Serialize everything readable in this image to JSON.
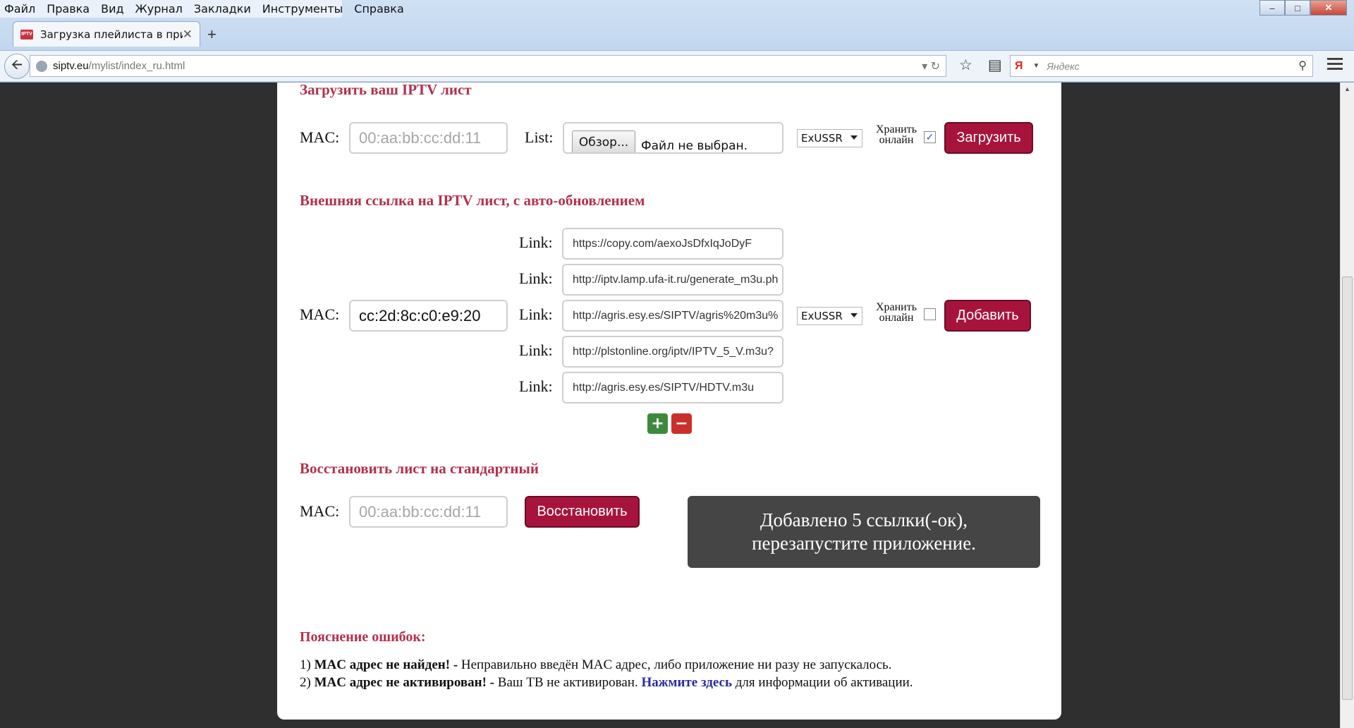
{
  "browser": {
    "menu": [
      "Файл",
      "Правка",
      "Вид",
      "Журнал",
      "Закладки",
      "Инструменты",
      "Справка"
    ],
    "tab_title": "Загрузка плейлиста в при...",
    "tab_favicon_text": "IPTV",
    "url_host": "siptv.eu",
    "url_path": "/mylist/index_ru.html",
    "search_engine": "Я",
    "search_placeholder": "Яндекс"
  },
  "upload": {
    "heading": "Загрузить ваш IPTV лист",
    "mac_label": "MAC:",
    "mac_placeholder": "00:aa:bb:cc:dd:11",
    "list_label": "List:",
    "browse_label": "Обзор...",
    "no_file_text": "Файл не выбран.",
    "region": "ExUSSR",
    "store_label_1": "Хранить",
    "store_label_2": "онлайн",
    "store_checked": true,
    "submit_label": "Загрузить"
  },
  "external": {
    "heading": "Внешняя ссылка на IPTV лист, с авто-обновлением",
    "mac_label": "MAC:",
    "mac_value": "cc:2d:8c:c0:e9:20",
    "link_label": "Link:",
    "links": [
      "https://copy.com/aexoJsDfxIqJoDyF",
      "http://iptv.lamp.ufa-it.ru/generate_m3u.ph",
      "http://agris.esy.es/SIPTV/agris%20m3u%",
      "http://plstonline.org/iptv/IPTV_5_V.m3u?",
      "http://agris.esy.es/SIPTV/HDTV.m3u"
    ],
    "region": "ExUSSR",
    "store_label_1": "Хранить",
    "store_label_2": "онлайн",
    "store_checked": false,
    "add_label": "Добавить",
    "plus": "+",
    "minus": "−"
  },
  "restore": {
    "heading": "Восстановить лист на стандартный",
    "mac_label": "MAC:",
    "mac_placeholder": "00:aa:bb:cc:dd:11",
    "button_label": "Восстановить"
  },
  "toast": {
    "line1": "Добавлено 5 ссылки(-ок),",
    "line2": "перезапустите приложение."
  },
  "errors": {
    "heading": "Пояснение ошибок:",
    "e1_num": "1)",
    "e1_bold": "MAC адрес не найден! -",
    "e1_text": "Неправильно введён MAC адрес, либо приложение ни разу не запускалось.",
    "e2_num": "2)",
    "e2_bold": "MAC адрес не активирован! -",
    "e2_text": "Ваш ТВ не активирован.",
    "e2_link": "Нажмите здесь",
    "e2_tail": "для информации об активации."
  }
}
